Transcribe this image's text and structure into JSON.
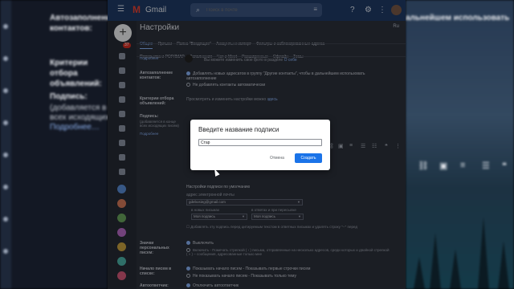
{
  "background": {
    "left_heading": "Автозаполнение контактов:",
    "left_section": "Критерии отбора объявлений:",
    "left_signature": "Подпись:",
    "left_signature_sub1": "(добавляется в конце",
    "left_signature_sub2": "всех исходящих писем)",
    "left_more": "Подробнее…",
    "right_heading": "альнейшем использовать"
  },
  "topbar": {
    "app_name": "Gmail",
    "search_placeholder": "Поиск в почте"
  },
  "rail": {
    "badge": "37"
  },
  "settings": {
    "title": "Настройки",
    "lang": "Ru",
    "tabs_row1": [
      "Общие",
      "Ярлыки",
      "Папка \"Входящие\"",
      "Аккаунты и импорт",
      "Фильтры и заблокированные адреса"
    ],
    "tabs_row2": [
      "Пересылка и POP/IMAP",
      "Дополнения",
      "Чат и Meet",
      "Расширенные",
      "Офлайн",
      "Темы"
    ],
    "profile_more": "Подробнее",
    "profile_note": "Вы можете изменить свое фото в разделе",
    "profile_note_link": "О себе",
    "autocomplete_label": "Автозаполнение контактов:",
    "autocomplete_opt1": "Добавлять новых адресатов в группу \"Другие контакты\", чтобы в дальнейшем использовать автозаполнение",
    "autocomplete_opt2": "Не добавлять контакты автоматически",
    "ads_label": "Критерии отбора объявлений:",
    "ads_text": "Просмотреть и изменить настройки можно",
    "ads_link": "здесь",
    "signature_label": "Подпись:",
    "signature_sub": "(добавляется в конце всех исходящих писем)",
    "signature_more": "Подробнее",
    "sig_defaults_title": "Настройки подписи по умолчанию",
    "sig_email_label": "адрес электронной почты",
    "sig_email_value": "gdebosieg@gmail.com",
    "sig_new_label": "в новых письмах",
    "sig_new_value": "Моя подпись",
    "sig_reply_label": "в ответах и при пересылке",
    "sig_reply_value": "Моя подпись",
    "sig_checkbox_text": "Добавлять эту подпись перед цитируемым текстом в ответных письмах и удалять строку \"--\" перед",
    "personal_label": "Значки персональных писем:",
    "personal_opt1": "Выключить",
    "personal_opt2": "Включить - Помечать стрелкой ( › ) письма, отправленные на несколько адресов, среди которых и двойной стрелкой ( » ) – сообщения, адресованные только мне",
    "snippets_label": "Начало писем в списке:",
    "snippets_opt1": "Показывать начало писем - Показывать первые строчки писем",
    "snippets_opt2": "Не показывать начало писем - Показывать только тему",
    "autoreply_label": "Автоответчик:",
    "autoreply_opt1": "Отключить автоответчик"
  },
  "dialog": {
    "title": "Введите название подписи",
    "input_value": "Стар",
    "cancel_label": "Отмена",
    "create_label": "Создать"
  },
  "colors": {
    "primary_button": "#1a73e8",
    "topbar": "#1f3b66",
    "link": "#8ab4f8"
  }
}
